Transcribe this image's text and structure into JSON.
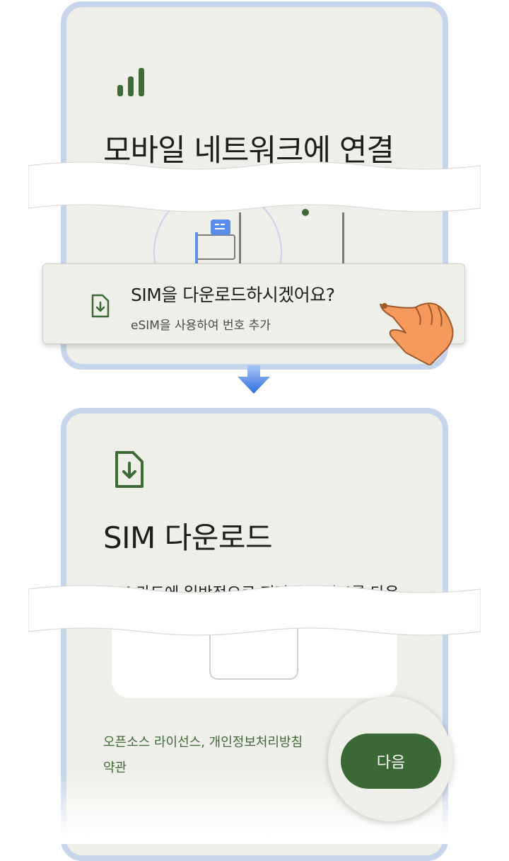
{
  "top_screen": {
    "icon": "signal-bars-icon",
    "title": "모바일 네트워크에 연결"
  },
  "sim_prompt": {
    "icon": "sim-download-icon",
    "title": "SIM을 다운로드하시겠어요?",
    "subtitle": "eSIM을 사용하여 번호 추가"
  },
  "transition_icon": "arrow-down-icon",
  "bottom_screen": {
    "icon": "sim-download-icon",
    "title": "SIM 다운로드",
    "description": "SIM 카드에 일반적으로 저장되는 정보를 다운",
    "links": {
      "license": "오픈소스 라이선스, 개인정보처리방침",
      "terms": "약관"
    },
    "next_button": "다음"
  },
  "colors": {
    "accent_green": "#3b6936",
    "screen_bg": "#efefe9",
    "frame": "#c6d4ec",
    "arrow_blue": "#4a86e8",
    "hand": "#f59a5c"
  }
}
